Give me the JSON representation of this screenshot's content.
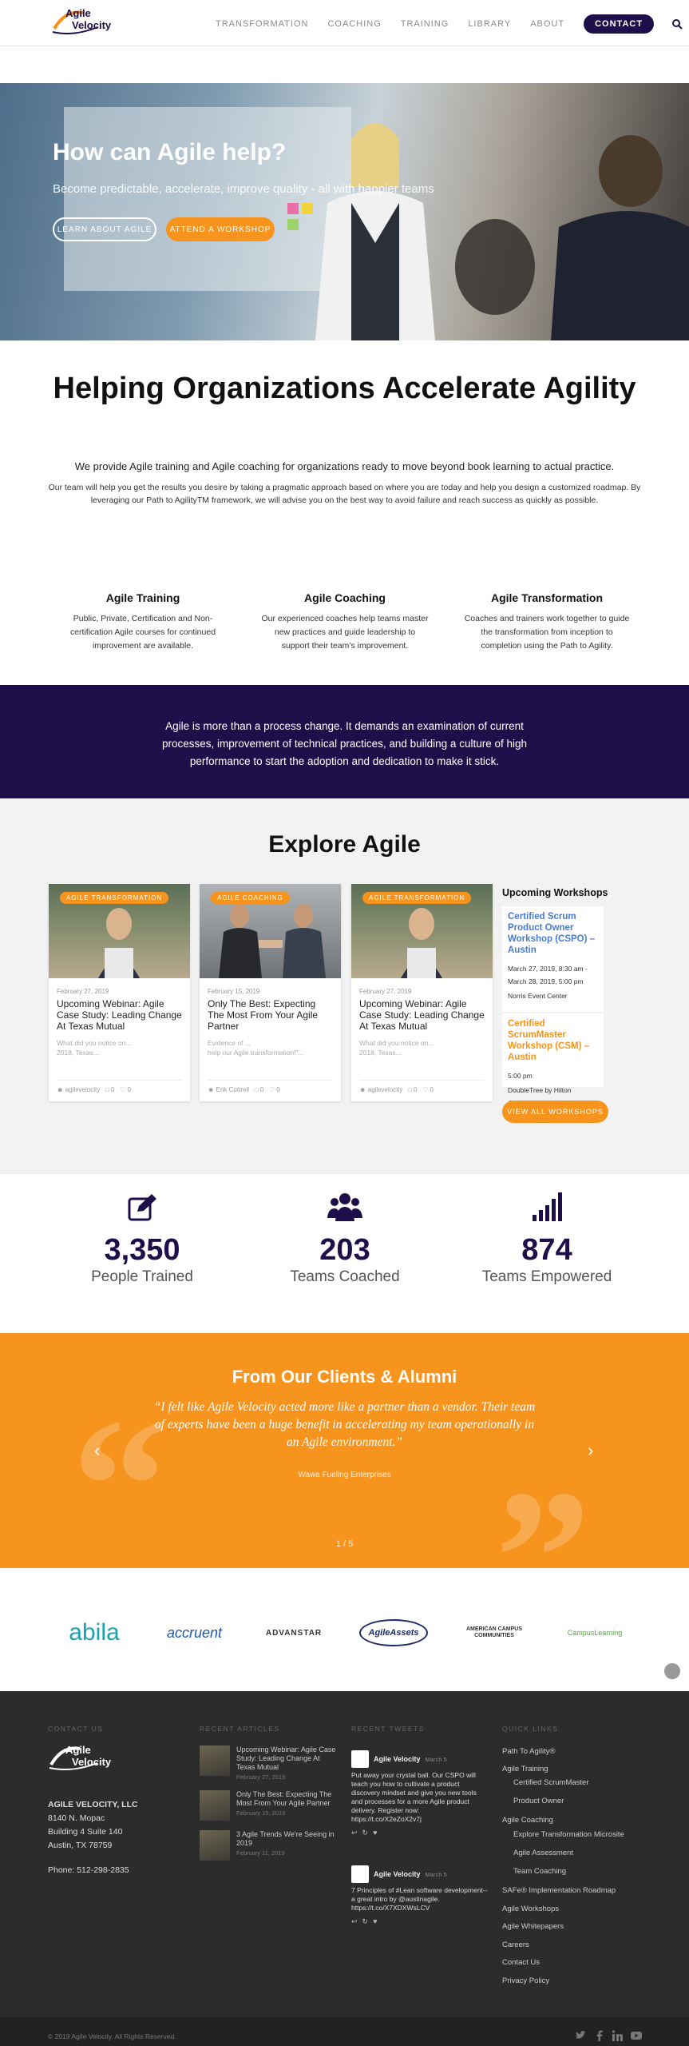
{
  "header": {
    "logo_line1": "Agile",
    "logo_line2": "Velocity",
    "nav": [
      "TRANSFORMATION",
      "COACHING",
      "TRAINING",
      "LIBRARY",
      "ABOUT"
    ],
    "contact": "CONTACT"
  },
  "hero": {
    "title": "How can Agile help?",
    "subtitle": "Become predictable, accelerate, improve quality - all with happier teams",
    "btn_learn": "LEARN ABOUT AGILE",
    "btn_attend": "ATTEND A WORKSHOP"
  },
  "intro": {
    "title": "Helping Organizations Accelerate Agility",
    "lead": "We provide Agile training and Agile coaching for organizations ready to move beyond book learning to actual practice.",
    "body": "Our team will help you get the results you desire by taking a pragmatic approach based on where you are today and help you design a customized roadmap. By leveraging our Path to AgilityTM framework,  we will advise you on the best way to avoid failure and reach success as quickly as possible."
  },
  "services": [
    {
      "title": "Agile Training",
      "text": "Public, Private, Certification and Non-certification Agile courses for continued improvement are available."
    },
    {
      "title": "Agile Coaching",
      "text": "Our experienced coaches help teams master new practices and guide leadership to support their team’s improvement."
    },
    {
      "title": "Agile Transformation",
      "text": "Coaches and trainers work together to guide the transformation from inception to completion using the Path to Agility."
    }
  ],
  "banner": "Agile is more than a process change. It demands an examination of current processes, improvement of technical practices, and building a culture of high performance to start the adoption and dedication to make it stick.",
  "explore": {
    "title": "Explore Agile",
    "cards": [
      {
        "tag": "AGILE TRANSFORMATION",
        "date": "February 27, 2019",
        "title": "Upcoming Webinar: Agile Case Study: Leading Change At Texas Mutual",
        "excerpt": "What did you notice on...",
        "excerpt2": "2018, Texas...",
        "author": "agilevelocity",
        "comments": "0",
        "likes": "0"
      },
      {
        "tag": "AGILE COACHING",
        "date": "February 15, 2019",
        "title": "Only The Best: Expecting The Most From Your Agile Partner",
        "excerpt": "Evidence of ...",
        "excerpt2": "help our Agile transformation!”...",
        "author": "Erik Cottrell",
        "comments": "0",
        "likes": "0"
      },
      {
        "tag": "AGILE TRANSFORMATION",
        "date": "February 27, 2019",
        "title": "Upcoming Webinar: Agile Case Study: Leading Change At Texas Mutual",
        "excerpt": "What did you notice on...",
        "excerpt2": "2018, Texas...",
        "author": "agilevelocity",
        "comments": "0",
        "likes": "0"
      }
    ],
    "workshops_title": "Upcoming Workshops",
    "workshops": [
      {
        "title": "Certified Scrum Product Owner Workshop (CSPO) – Austin",
        "when": "March 27, 2019, 8:30 am - March 28, 2019, 5:00 pm",
        "where": "Norris Event Center",
        "color": "#4a7bd0"
      },
      {
        "title": "Certified ScrumMaster Workshop (CSM) – Austin",
        "when": "5:00 pm",
        "where": "DoubleTree by Hilton Arboretum",
        "color": "#f7941d"
      }
    ],
    "workshops_btn": "VIEW ALL WORKSHOPS"
  },
  "stats": [
    {
      "icon": "pencil-square-icon",
      "value": "3,350",
      "label": "People Trained"
    },
    {
      "icon": "users-icon",
      "value": "203",
      "label": "Teams Coached"
    },
    {
      "icon": "signal-bars-icon",
      "value": "874",
      "label": "Teams Empowered"
    }
  ],
  "testimonials": {
    "title": "From Our Clients & Alumni",
    "quote": "“I felt like Agile Velocity acted more like a partner than a vendor. Their team of experts have been a huge benefit in accelerating my team operationally in an Agile environment.”",
    "author": "Wawa Fueling Enterprises",
    "page": "1 / 5",
    "prev": "‹",
    "next": "›"
  },
  "clients": [
    "abila",
    "accruent",
    "ADVANSTAR",
    "AgileAssets",
    "AMERICAN CAMPUS COMMUNITIES",
    "CampusLearning"
  ],
  "footer": {
    "contact_h": "CONTACT US",
    "articles_h": "RECENT ARTICLES",
    "tweets_h": "RECENT TWEETS",
    "links_h": "QUICK LINKS",
    "company": "AGILE VELOCITY, LLC",
    "addr1": "8140 N. Mopac",
    "addr2": "Building 4 Suite 140",
    "addr3": "Austin, TX 78759",
    "phone": "Phone: 512-298-2835",
    "articles": [
      {
        "title": "Upcoming Webinar: Agile Case Study: Leading Change At Texas Mutual",
        "date": "February 27, 2019"
      },
      {
        "title": "Only The Best: Expecting The Most From Your Agile Partner",
        "date": "February 15, 2019"
      },
      {
        "title": "3 Agile Trends We're Seeing in 2019",
        "date": "February 11, 2019"
      }
    ],
    "tweets": [
      {
        "name": "Agile Velocity",
        "date": "March 5",
        "body": "Put away your crystal ball. Our CSPO will teach you how to cultivate a product discovery mindset and give you new tools and processes for a more Agile product delivery. Register now: https://t.co/X2eZoX2v7j"
      },
      {
        "name": "Agile Velocity",
        "date": "March 5",
        "body": "7 Principles of #Lean software development--a great intro by @austinagile. https://t.co/X7XDXWsLCV"
      }
    ],
    "links": [
      "Path To Agility®",
      "Agile Training",
      "Certified ScrumMaster",
      "Product Owner",
      "Agile Coaching",
      "Explore Transformation Microsite",
      "Agile Assessment",
      "Team Coaching",
      "SAFe® Implementation Roadmap",
      "Agile Workshops",
      "Agile Whitepapers",
      "Careers",
      "Contact Us",
      "Privacy Policy"
    ],
    "copyright": "© 2019 Agile Velocity. All Rights Reserved."
  }
}
